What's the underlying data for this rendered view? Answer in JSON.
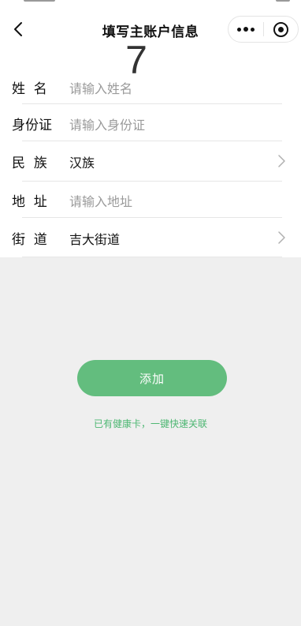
{
  "nav": {
    "title": "填写主账户信息",
    "back_icon": "chevron-left-icon",
    "more_icon": "more-dots-icon",
    "close_icon": "target-circle-icon"
  },
  "badge_number": "7",
  "form": {
    "rows": [
      {
        "label": "姓  名",
        "value": "",
        "placeholder": "请输入姓名",
        "has_arrow": false
      },
      {
        "label": "身份证",
        "value": "",
        "placeholder": "请输入身份证",
        "has_arrow": false
      },
      {
        "label": "民  族",
        "value": "汉族",
        "placeholder": "",
        "has_arrow": true
      },
      {
        "label": "地  址",
        "value": "",
        "placeholder": "请输入地址",
        "has_arrow": false
      },
      {
        "label": "街  道",
        "value": "吉大街道",
        "placeholder": "",
        "has_arrow": true
      }
    ]
  },
  "actions": {
    "add_label": "添加",
    "link_label": "已有健康卡，一键快速关联"
  },
  "colors": {
    "accent": "#63bd7e",
    "link": "#4eb773",
    "background": "#efefef"
  }
}
